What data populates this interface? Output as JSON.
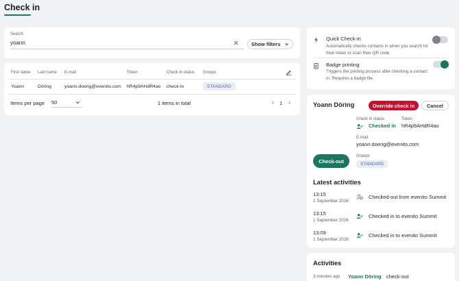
{
  "page": {
    "title": "Check in"
  },
  "search": {
    "label": "Search",
    "value": "yoann",
    "filters_label": "Show filters"
  },
  "table": {
    "columns": [
      "First name",
      "Last name",
      "E-mail",
      "Token",
      "Check in status",
      "Groups"
    ],
    "rows": [
      {
        "first_name": "Yoann",
        "last_name": "Döring",
        "email": "yoann.doerig@evenito.com",
        "token": "hR4p9AHdR4ao",
        "status": "check-in",
        "group": "STANDARD"
      }
    ],
    "items_per_page_label": "Items per page",
    "items_per_page": "50",
    "total": "1 items in total",
    "page": "1"
  },
  "settings": {
    "quick_checkin": {
      "title": "Quick Check-in",
      "description": "Automatically checks contacts in when you search for their token or scan their QR code.",
      "enabled": false
    },
    "badge_printing": {
      "title": "Badge printing",
      "description": "Triggers the printing process after checking a contact in. Requires a badge file.",
      "enabled": true
    }
  },
  "detail": {
    "name": "Yoann Döring",
    "override_label": "Override check in",
    "cancel_label": "Cancel",
    "status_label": "Check in status",
    "status_value": "Checked in",
    "token_label": "Token",
    "token_value": "hR4p9AHdR4ao",
    "email_label": "E-mail",
    "email_value": "yoann.doerig@evenito.com",
    "checkout_label": "Check-out",
    "groups_label": "Groups",
    "group_value": "STANDARD"
  },
  "latest_activities": {
    "title": "Latest activities",
    "items": [
      {
        "time": "13:15",
        "date": "1 September 2026",
        "icon": "checkout-user-icon",
        "text": "Checked-out from evenito Summit"
      },
      {
        "time": "13:15",
        "date": "1 September 2026",
        "icon": "checkin-user-icon",
        "text": "Checked in to evenito Summit"
      },
      {
        "time": "13:09",
        "date": "1 September 2026",
        "icon": "checkin-user-icon",
        "text": "Checked in to evenito Summit"
      }
    ]
  },
  "activities": {
    "title": "Activities",
    "items": [
      {
        "ago": "3 minutes ago",
        "user": "Yoann Döring",
        "action": "check-out"
      }
    ]
  },
  "colors": {
    "accent": "#1b7661",
    "danger": "#c8102e",
    "badge_bg": "#e9edf6",
    "badge_text": "#4a6aa7"
  }
}
